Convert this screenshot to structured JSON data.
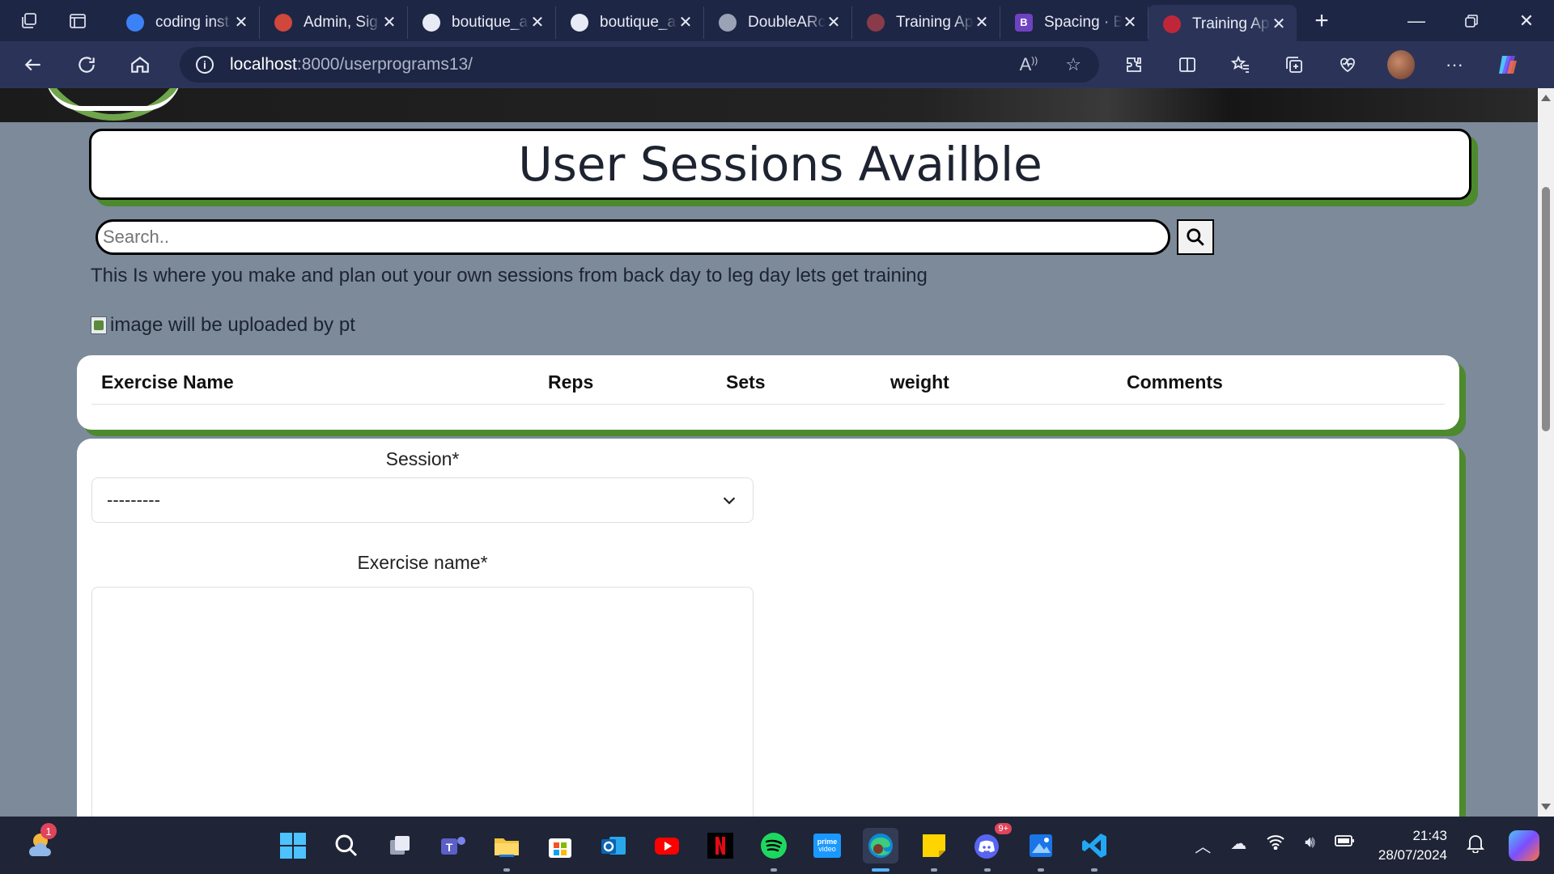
{
  "browser": {
    "tabs": [
      {
        "label": "coding inst",
        "icon": "bing-icon",
        "color": "#3b82f6"
      },
      {
        "label": "Admin, Sig",
        "icon": "admin-icon",
        "color": "#d0473c"
      },
      {
        "label": "boutique_a",
        "icon": "github-icon",
        "color": "#e8ebf5"
      },
      {
        "label": "boutique_a",
        "icon": "github-icon",
        "color": "#e8ebf5"
      },
      {
        "label": "DoubleARc",
        "icon": "google-icon",
        "color": "#9aa3b6"
      },
      {
        "label": "Training Ap",
        "icon": "training-icon",
        "color": "#8a3b4a"
      },
      {
        "label": "Spacing · B",
        "icon": "bootstrap-icon",
        "color": "#6f42c1",
        "glyph": "B"
      },
      {
        "label": "Training Ap",
        "icon": "training-icon",
        "color": "#c0263a",
        "active": true
      }
    ],
    "url_host": "localhost",
    "url_path": ":8000/userprograms13/"
  },
  "page": {
    "title": "User Sessions Availble",
    "search_placeholder": "Search..",
    "description": "This Is where you make and plan out your own sessions from back day to leg day lets get training",
    "image_alt": "image will be uploaded by pt",
    "table_headers": [
      "Exercise Name",
      "Reps",
      "Sets",
      "weight",
      "Comments"
    ],
    "form": {
      "session_label": "Session*",
      "session_value": "---------",
      "exercise_label": "Exercise name*"
    }
  },
  "taskbar": {
    "weather_badge": "1",
    "discord_badge": "9+",
    "time": "21:43",
    "date": "28/07/2024"
  },
  "colors": {
    "accent_green": "#4c8a2d",
    "page_bg": "#7c8a9a",
    "browser_dark": "#1e2645"
  }
}
